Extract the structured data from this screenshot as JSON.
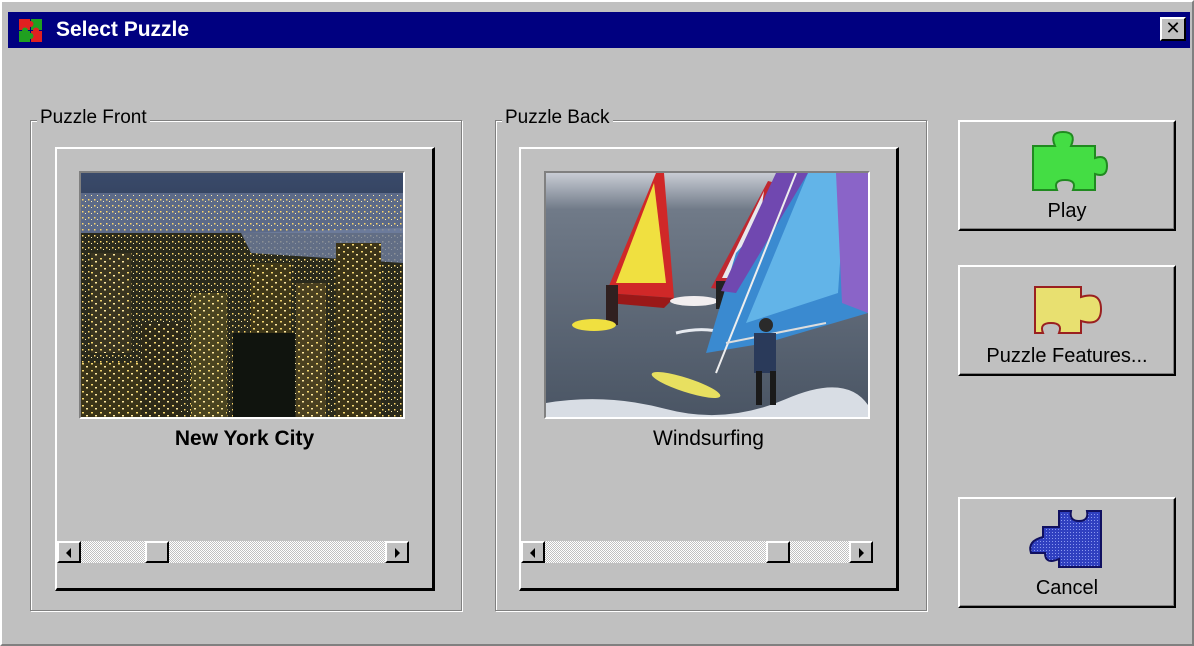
{
  "window": {
    "title": "Select Puzzle",
    "close_glyph": "✕",
    "title_icon": "puzzle-app-icon"
  },
  "front": {
    "group_label": "Puzzle Front",
    "caption": "New York City",
    "image": "new-york-city-night-aerial-photo",
    "scroll_position": 0.23
  },
  "back": {
    "group_label": "Puzzle Back",
    "caption": "Windsurfing",
    "image": "windsurfing-photo",
    "scroll_position": 0.79
  },
  "buttons": {
    "play": {
      "label": "Play",
      "icon": "green-puzzle-piece-icon",
      "color": "#44dd44"
    },
    "features": {
      "label": "Puzzle Features...",
      "icon": "yellow-puzzle-piece-icon",
      "color": "#e8e070"
    },
    "cancel": {
      "label": "Cancel",
      "icon": "blue-puzzle-piece-icon",
      "color": "#3040c0"
    }
  },
  "colors": {
    "titlebar": "#000080",
    "face": "#c0c0c0"
  }
}
